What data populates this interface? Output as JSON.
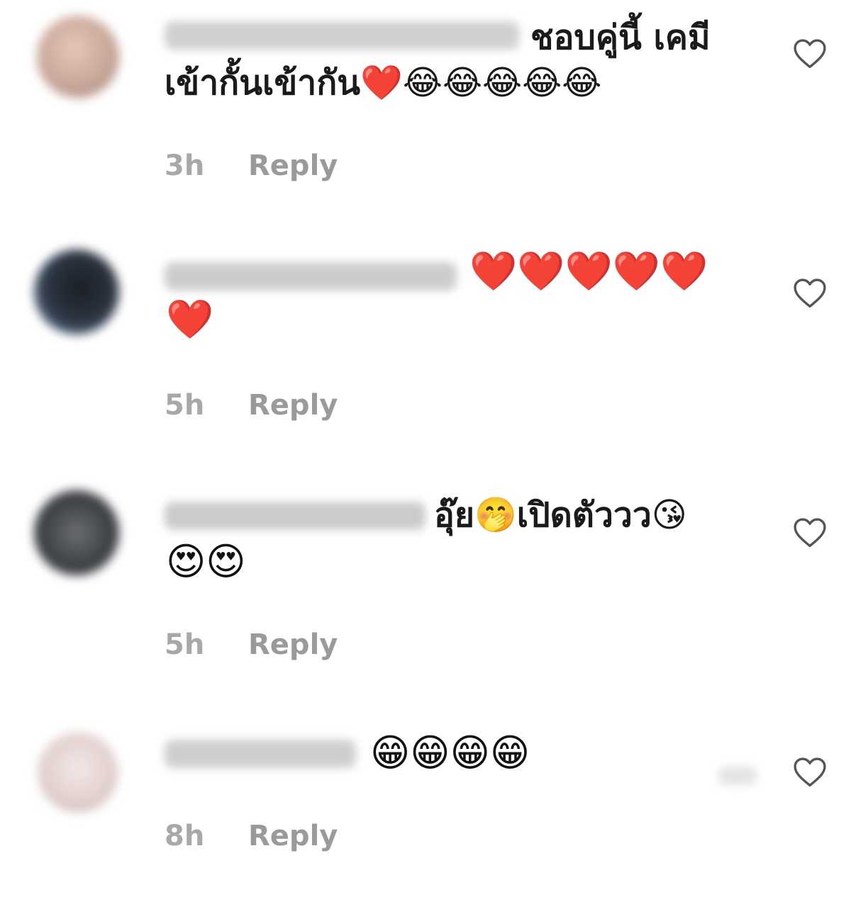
{
  "comments": [
    {
      "text_line1": "ชอบคู่นี้ เคมี",
      "text_line2": "เข้ากั้นเข้ากัน❤️😂😂😂😂😂",
      "emoji_line": "",
      "time": "3h",
      "reply_label": "Reply",
      "avatar_color": "#c9a79a"
    },
    {
      "text_line1": "❤️❤️❤️❤️❤️",
      "text_line2": "",
      "emoji_line": "❤️",
      "time": "5h",
      "reply_label": "Reply",
      "avatar_color": "#2c3440"
    },
    {
      "text_line1": "อุ๊ย🤭เปิดตัววว😘",
      "text_line2": "",
      "emoji_line": "😍😍",
      "time": "5h",
      "reply_label": "Reply",
      "avatar_color": "#3f4247"
    },
    {
      "text_line1": "😁😁😁😁",
      "text_line2": "",
      "emoji_line": "",
      "time": "8h",
      "reply_label": "Reply",
      "avatar_color": "#e2d2d0"
    }
  ],
  "icons": {
    "like": "heart-outline-icon"
  }
}
